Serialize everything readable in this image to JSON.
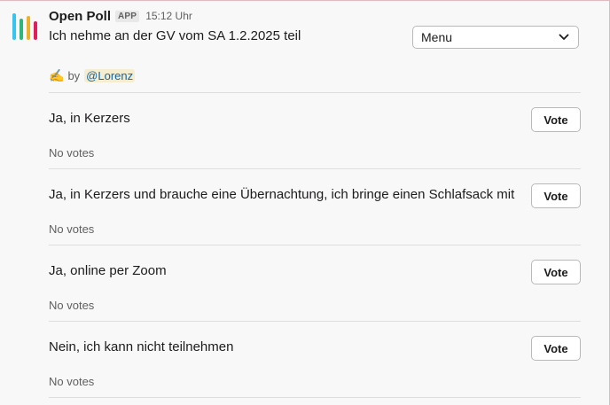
{
  "message": {
    "app_name": "Open Poll",
    "app_badge": "APP",
    "timestamp": "15:12 Uhr",
    "question": "Ich nehme an der GV vom SA 1.2.2025 teil",
    "menu": {
      "selected": "Menu"
    },
    "author": {
      "prefix_icon": "writing-hand-icon",
      "by_text": "by",
      "mention": "@Lorenz"
    }
  },
  "poll": {
    "vote_label": "Vote",
    "options": [
      {
        "label": "Ja, in Kerzers",
        "votes": "No votes"
      },
      {
        "label": "Ja, in Kerzers und brauche eine Übernachtung, ich bringe einen Schlafsack mit",
        "votes": "No votes"
      },
      {
        "label": "Ja, online per Zoom",
        "votes": "No votes"
      },
      {
        "label": "Nein, ich kann nicht teilnehmen",
        "votes": "No votes"
      }
    ]
  },
  "colors": {
    "icon_bars": [
      "#36c5f0",
      "#2eb67d",
      "#ecb22e",
      "#e01e5a"
    ],
    "mention_text": "#1264a3",
    "mention_bg": "#f4edd0"
  }
}
